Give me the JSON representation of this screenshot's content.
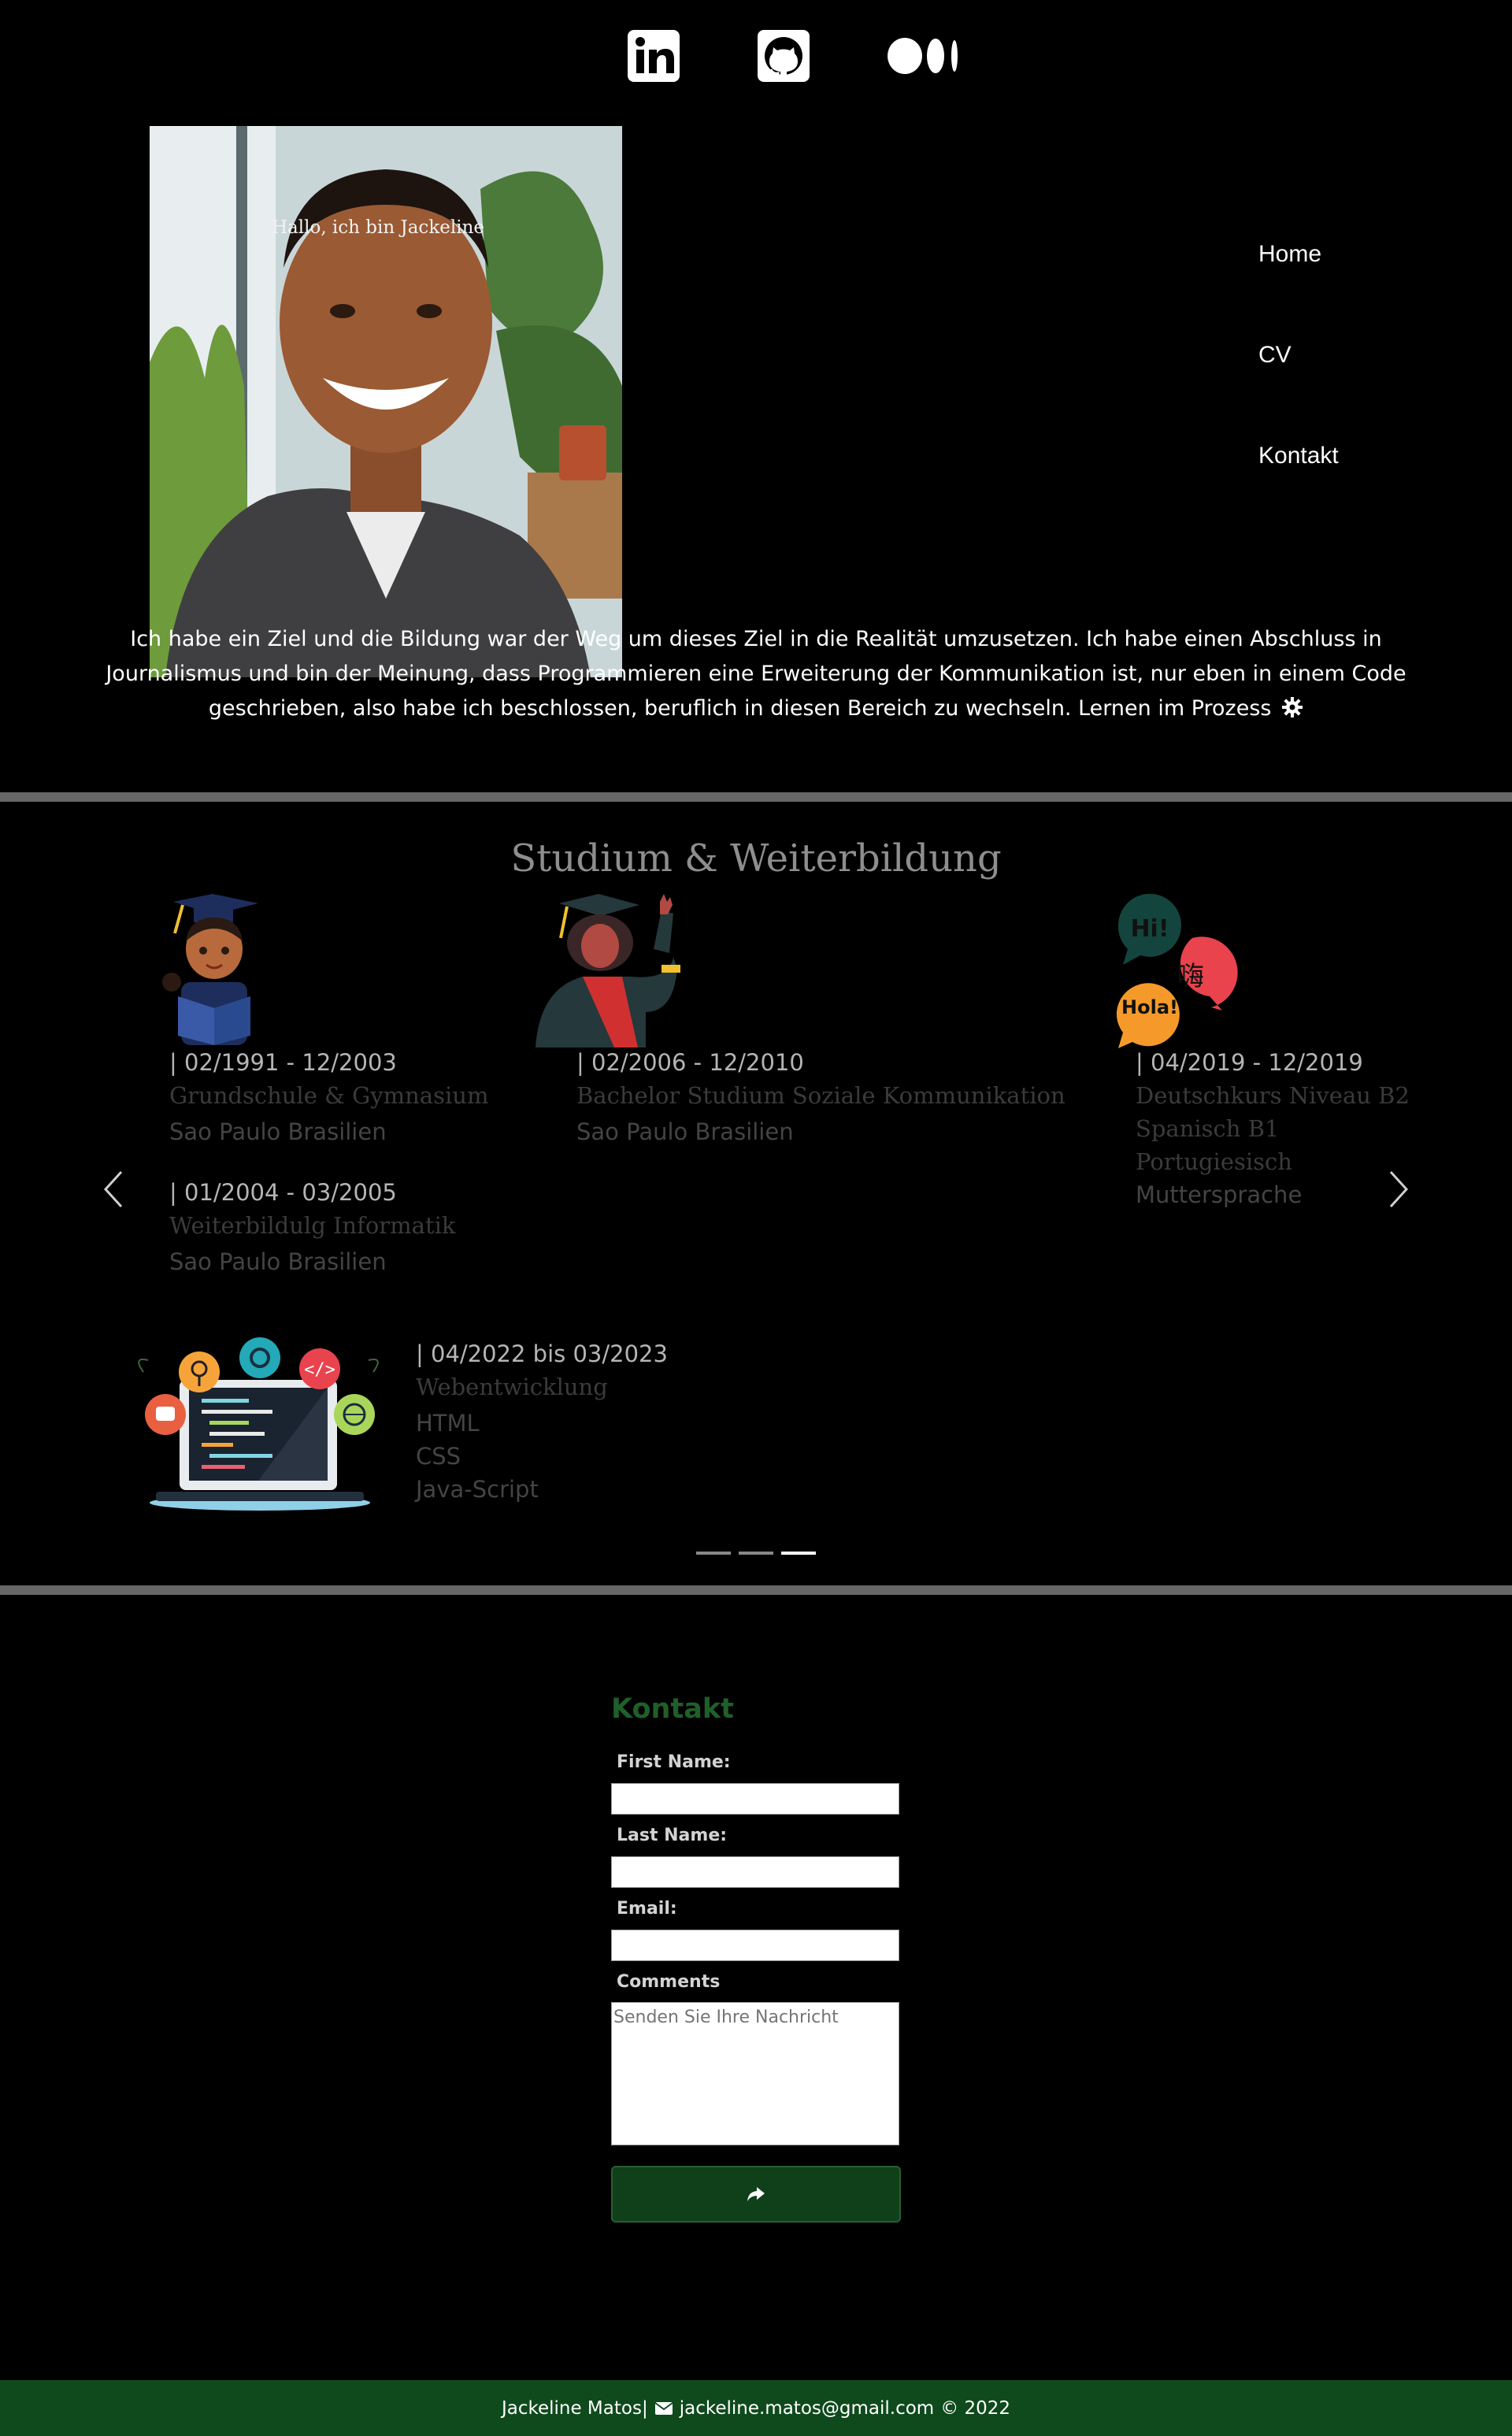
{
  "social": {
    "linkedin_label": "in",
    "icons": [
      "linkedin-icon",
      "github-icon",
      "medium-icon"
    ]
  },
  "hero": {
    "greeting": "Hallo, ich bin Jackeline",
    "intro": "Ich habe ein Ziel und die Bildung war der Weg um dieses Ziel in die Realität umzusetzen. Ich habe einen Abschluss in Journalismus und bin der Meinung, dass Programmieren eine Erweiterung der Kommunikation ist, nur eben in einem Code geschrieben, also habe ich beschlossen, beruflich in diesen Bereich zu wechseln. Lernen im Prozess",
    "intro_icon": "gear-icon"
  },
  "nav": {
    "items": [
      {
        "label": "Home"
      },
      {
        "label": "CV"
      },
      {
        "label": "Kontakt"
      }
    ]
  },
  "education": {
    "title": "Studium & Weiterbildung",
    "entries": [
      {
        "date": "| 02/1991 - 12/2003",
        "title": "Grundschule & Gymnasium",
        "lines": [
          "Sao Paulo Brasilien"
        ]
      },
      {
        "date": "| 01/2004 - 03/2005",
        "title": "Weiterbildulg Informatik",
        "lines": [
          "Sao Paulo Brasilien"
        ]
      },
      {
        "date": "| 02/2006 - 12/2010",
        "title": "Bachelor Studium Soziale Kommunikation",
        "lines": [
          "Sao Paulo Brasilien"
        ]
      },
      {
        "date": "| 04/2019 - 12/2019",
        "title": "Deutschkurs Niveau B2",
        "lines": [
          "Spanisch B1",
          "Portugiesisch",
          "Muttersprache"
        ]
      },
      {
        "date": "| 04/2022 bis 03/2023",
        "title": "Webentwicklung",
        "lines": [
          "HTML",
          "CSS",
          "Java-Script"
        ]
      }
    ],
    "bubbles": {
      "hi": "Hi!",
      "hai": "嗨",
      "hola": "Hola!"
    },
    "carousel": {
      "slide_count": 3,
      "active_index": 2
    }
  },
  "contact": {
    "title": "Kontakt",
    "first_name_label": "First Name:",
    "last_name_label": "Last Name:",
    "email_label": "Email:",
    "comments_label": "Comments",
    "comments_placeholder": "Senden Sie Ihre Nachricht",
    "submit_icon": "share-icon"
  },
  "footer": {
    "name": "Jackeline Matos|",
    "email": "jackeline.matos@gmail.com",
    "copyright": "© 2022",
    "icon": "envelope-icon"
  },
  "colors": {
    "background": "#000000",
    "accent_green": "#0f4a1c",
    "title_green": "#1f5f2a",
    "divider": "#666666"
  }
}
